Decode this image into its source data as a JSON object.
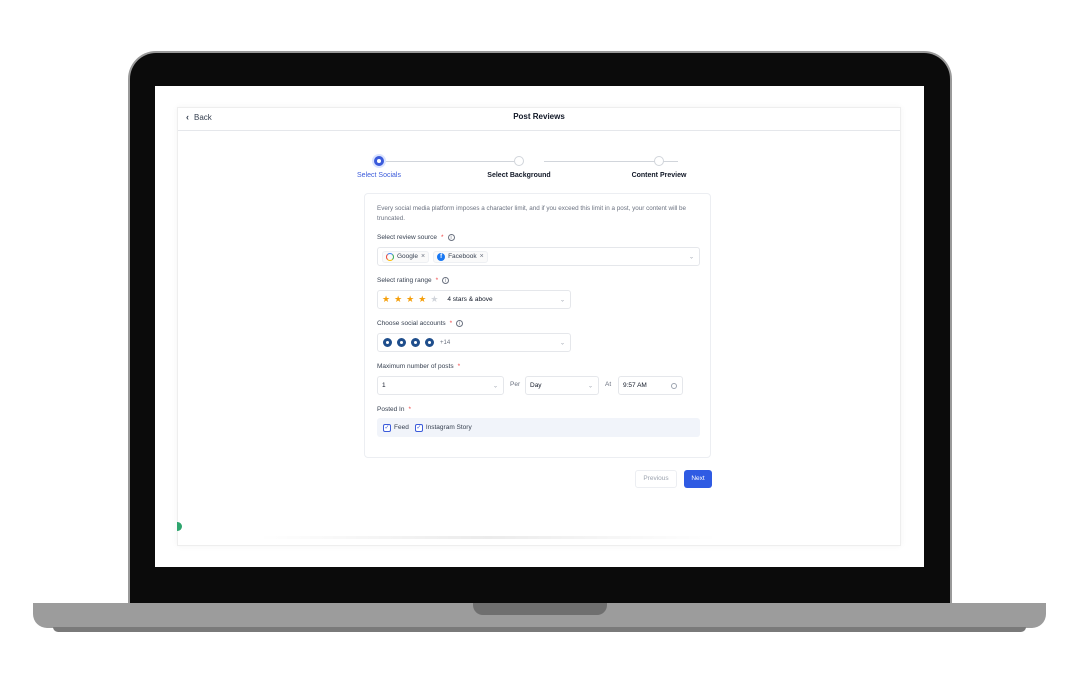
{
  "header": {
    "back_label": "Back",
    "title": "Post Reviews"
  },
  "stepper": {
    "steps": [
      {
        "label": "Select Socials",
        "state": "active"
      },
      {
        "label": "Select Background",
        "state": "inactive"
      },
      {
        "label": "Content Preview",
        "state": "inactive"
      }
    ]
  },
  "form": {
    "notice": "Every social media platform imposes a character limit, and if you exceed this limit in a post, your content will be truncated.",
    "review_source": {
      "label": "Select review source",
      "required": "*",
      "chips": [
        "Google",
        "Facebook"
      ]
    },
    "rating_range": {
      "label": "Select rating range",
      "required": "*",
      "stars_filled": 4,
      "stars_total": 5,
      "value": "4 stars & above"
    },
    "social_accounts": {
      "label": "Choose social accounts",
      "required": "*",
      "more": "+14"
    },
    "max_posts": {
      "label": "Maximum number of posts",
      "required": "*",
      "count": "1",
      "per_label": "Per",
      "period": "Day",
      "at_label": "At",
      "time": "9:57 AM"
    },
    "posted_in": {
      "label": "Posted In",
      "required": "*",
      "options": [
        "Feed",
        "Instagram Story"
      ]
    }
  },
  "footer": {
    "previous_label": "Previous",
    "next_label": "Next"
  },
  "colors": {
    "accent": "#2f5be3",
    "star": "#f59f0b",
    "avatar": "#1f4e8c"
  }
}
